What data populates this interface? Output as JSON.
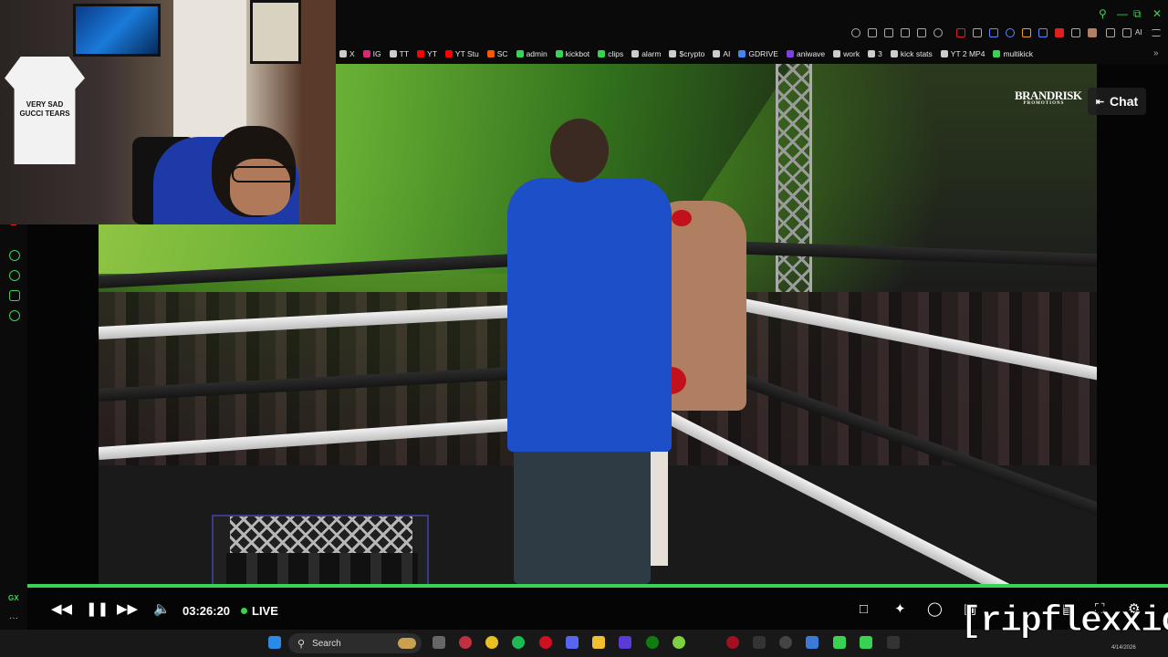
{
  "browser": {
    "bookmarks": [
      {
        "label": "X",
        "color": "#cccccc"
      },
      {
        "label": "IG",
        "color": "#d62976"
      },
      {
        "label": "TT",
        "color": "#cccccc"
      },
      {
        "label": "YT",
        "color": "#ff0000"
      },
      {
        "label": "YT Stu",
        "color": "#ff0000"
      },
      {
        "label": "SC",
        "color": "#ff5500"
      },
      {
        "label": "admin",
        "color": "#39d353"
      },
      {
        "label": "kickbot",
        "color": "#39d353"
      },
      {
        "label": "clips",
        "color": "#39d353"
      },
      {
        "label": "alarm",
        "color": "#cccccc"
      },
      {
        "label": "$crypto",
        "color": "#cccccc"
      },
      {
        "label": "AI",
        "color": "#cccccc"
      },
      {
        "label": "GDRIVE",
        "color": "#4285f4"
      },
      {
        "label": "aniwave",
        "color": "#7b3fe4"
      },
      {
        "label": "work",
        "color": "#cccccc"
      },
      {
        "label": "3",
        "color": "#cccccc"
      },
      {
        "label": "kick stats",
        "color": "#cccccc"
      },
      {
        "label": "YT 2 MP4",
        "color": "#cccccc"
      },
      {
        "label": "multikick",
        "color": "#39d353"
      }
    ],
    "ai_label": "AI"
  },
  "webcam": {
    "tshirt_text": "VERY SAD\nGUCCI TEARS"
  },
  "stream": {
    "brand_main": "BRANDRISK",
    "brand_sub": "PROMOTIONS",
    "chat_label": "Chat"
  },
  "player": {
    "time": "03:26:20",
    "live_label": "LIVE",
    "progress": 1.0,
    "accent": "#39d353"
  },
  "sidebar": {
    "gx_label": "GX"
  },
  "taskbar": {
    "search_placeholder": "Search",
    "date": "4/14/2026"
  },
  "overlay": {
    "watermark": "[ripflexxico]"
  }
}
